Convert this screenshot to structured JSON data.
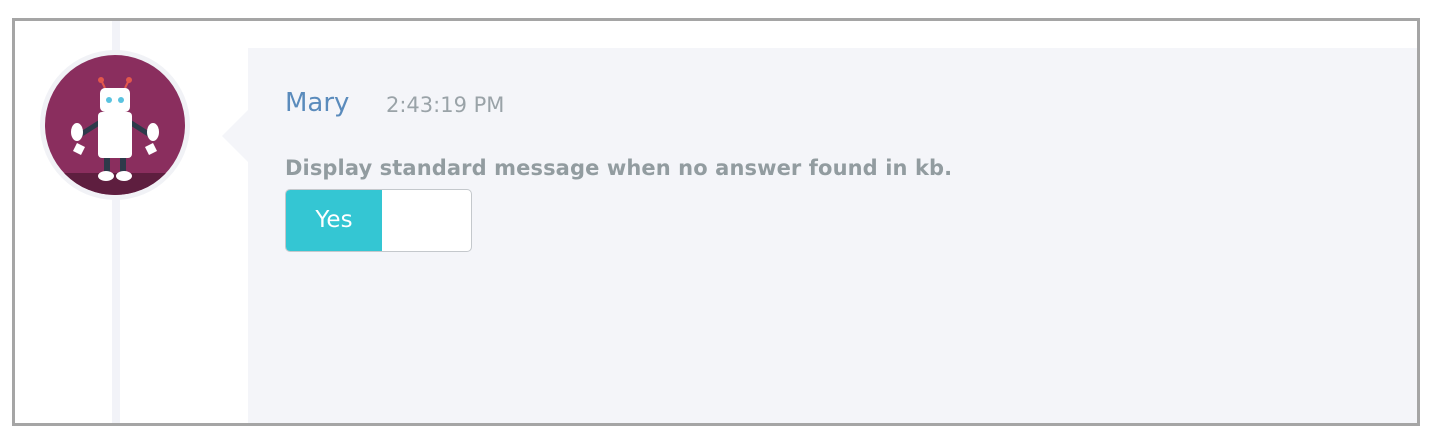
{
  "message": {
    "author": "Mary",
    "time": "2:43:19 PM",
    "text": "Display standard message when no answer found in kb.",
    "avatar_icon": "robot-icon"
  },
  "toggle": {
    "state_label": "Yes",
    "checked": true,
    "on_color": "#34c6d3"
  },
  "colors": {
    "author": "#5a8bbc",
    "avatar_bg": "#8a2e5e",
    "bubble_bg": "#f4f5f9"
  }
}
